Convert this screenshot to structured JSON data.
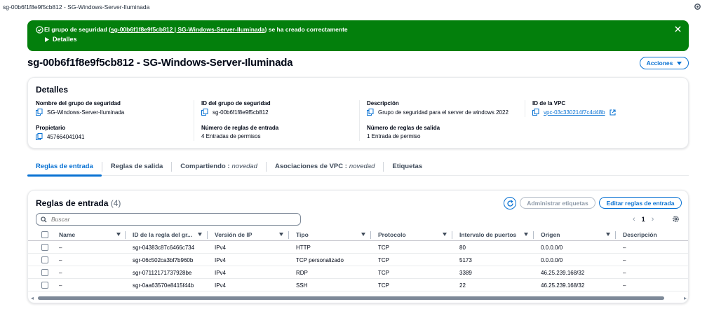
{
  "window": {
    "title": "sg-00b6f1f8e9f5cb812 - SG-Windows-Server-Iluminada",
    "settings_icon": "gear-icon"
  },
  "flash": {
    "prefix": "El grupo de seguridad (",
    "link": "sg-00b6f1f8e9f5cb812 | SG-Windows-Server-Iluminada",
    "suffix": ") se ha creado correctamente",
    "details_label": "Detalles",
    "bg_color": "#037f0c"
  },
  "page": {
    "title": "sg-00b6f1f8e9f5cb812 - SG-Windows-Server-Iluminada",
    "actions_label": "Acciones"
  },
  "details": {
    "heading": "Detalles",
    "name_label": "Nombre del grupo de seguridad",
    "name_value": "SG-Windows-Server-Iluminada",
    "id_label": "ID del grupo de seguridad",
    "id_value": "sg-00b6f1f8e9f5cb812",
    "desc_label": "Descripción",
    "desc_value": "Grupo de seguridad para el server de windows 2022",
    "vpc_label": "ID de la VPC",
    "vpc_value": "vpc-03c330214f7c4d48b",
    "owner_label": "Propietario",
    "owner_value": "457664041041",
    "inbound_label": "Número de reglas de entrada",
    "inbound_value": "4 Entradas de permisos",
    "outbound_label": "Número de reglas de salida",
    "outbound_value": "1 Entrada de permiso"
  },
  "tabs": [
    {
      "label": "Reglas de entrada",
      "tag": ""
    },
    {
      "label": "Reglas de salida",
      "tag": ""
    },
    {
      "label": "Compartiendo :",
      "tag": "novedad"
    },
    {
      "label": "Asociaciones de VPC :",
      "tag": "novedad"
    },
    {
      "label": "Etiquetas",
      "tag": ""
    }
  ],
  "rules": {
    "heading": "Reglas de entrada",
    "count": "(4)",
    "manage_tags_label": "Administrar etiquetas",
    "edit_label": "Editar reglas de entrada",
    "search_placeholder": "Buscar",
    "page_number": "1",
    "columns": [
      "Name",
      "ID de la regla del gr...",
      "Versión de IP",
      "Tipo",
      "Protocolo",
      "Intervalo de puertos",
      "Origen",
      "Descripción"
    ],
    "rows": [
      {
        "name": "–",
        "id": "sgr-04383c87c6466c734",
        "ip": "IPv4",
        "type": "HTTP",
        "protocol": "TCP",
        "ports": "80",
        "source": "0.0.0.0/0",
        "desc": "–"
      },
      {
        "name": "–",
        "id": "sgr-06c502ca3bf7b960b",
        "ip": "IPv4",
        "type": "TCP personalizado",
        "protocol": "TCP",
        "ports": "5173",
        "source": "0.0.0.0/0",
        "desc": "–"
      },
      {
        "name": "–",
        "id": "sgr-07112171737928be",
        "ip": "IPv4",
        "type": "RDP",
        "protocol": "TCP",
        "ports": "3389",
        "source": "46.25.239.168/32",
        "desc": "–"
      },
      {
        "name": "–",
        "id": "sgr-0aa63570e8415f44b",
        "ip": "IPv4",
        "type": "SSH",
        "protocol": "TCP",
        "ports": "22",
        "source": "46.25.239.168/32",
        "desc": "–"
      }
    ]
  },
  "colors": {
    "accent": "#0972d3",
    "success": "#037f0c",
    "text": "#000716"
  }
}
